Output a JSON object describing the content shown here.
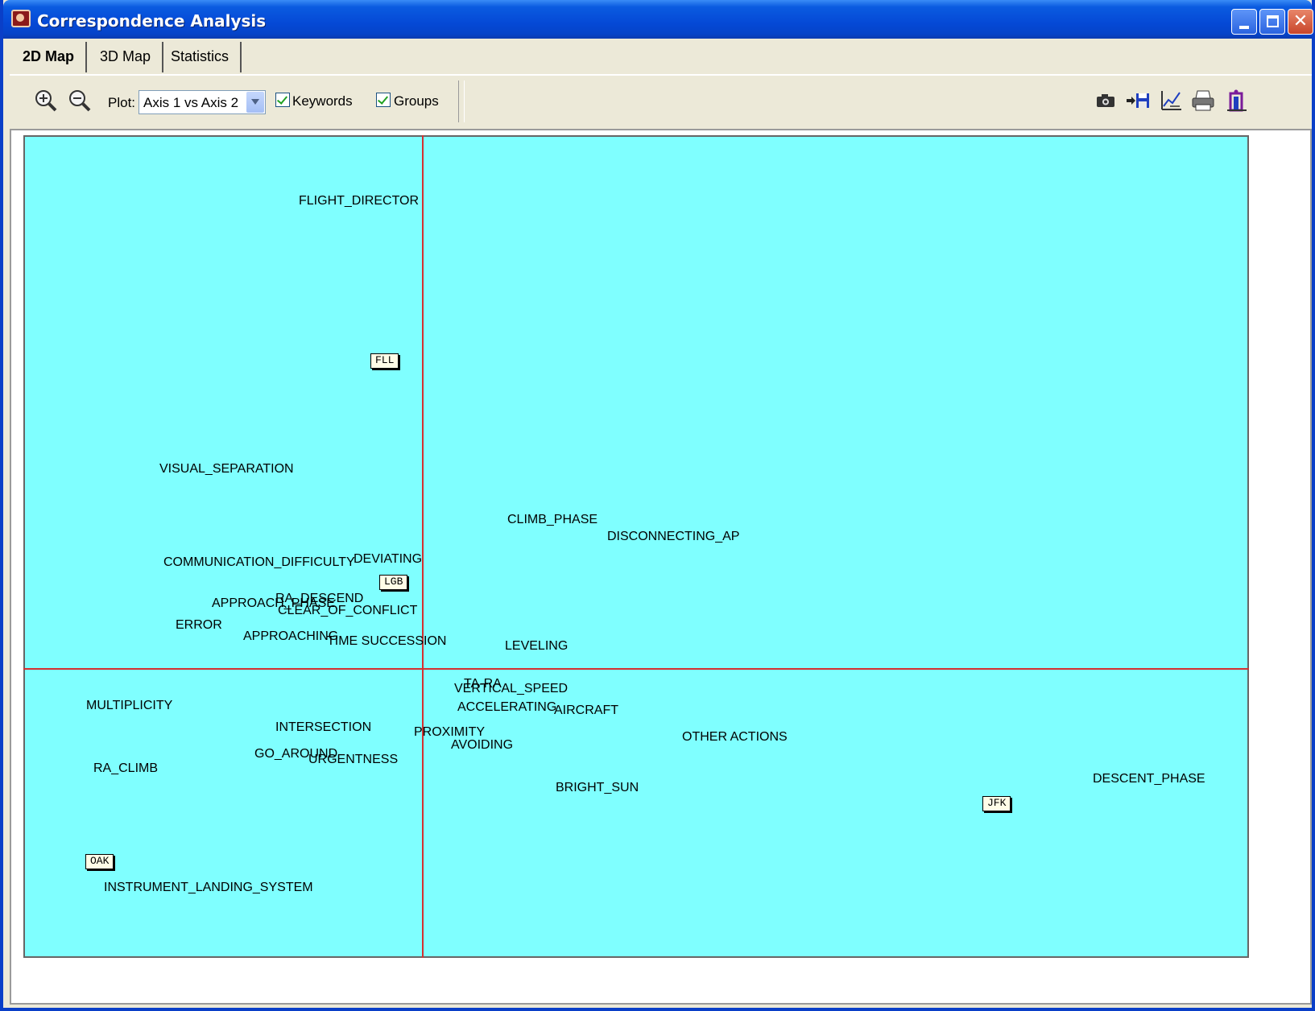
{
  "window": {
    "title": "Correspondence Analysis",
    "controls": {
      "minimize": "minimize",
      "maximize": "maximize",
      "close": "✕"
    }
  },
  "tabs": [
    {
      "label": "2D Map",
      "active": true
    },
    {
      "label": "3D Map",
      "active": false
    },
    {
      "label": "Statistics",
      "active": false
    }
  ],
  "toolbar": {
    "zoom_in_icon": "zoom-in-icon",
    "zoom_out_icon": "zoom-out-icon",
    "plot_label": "Plot:",
    "plot_value": "Axis 1 vs Axis 2",
    "keywords_label": "Keywords",
    "keywords_checked": true,
    "groups_label": "Groups",
    "groups_checked": true,
    "right_icons": [
      "camera-icon",
      "export-save-icon",
      "chart-settings-icon",
      "print-icon",
      "exit-icon"
    ]
  },
  "map": {
    "background": "#7fffff",
    "axis_color": "#d43030",
    "keywords": [
      "FLIGHT_DIRECTOR",
      "VISUAL_SEPARATION",
      "CLIMB_PHASE",
      "DISCONNECTING_AP",
      "COMMUNICATION_DIFFICULTY",
      "DEVIATING",
      "RA_DESCEND",
      "APPROACH_PHASE",
      "CLEAR_OF_CONFLICT",
      "ERROR",
      "APPROACHING",
      "TIME SUCCESSION",
      "LEVELING",
      "TA-RA",
      "VERTICAL_SPEED",
      "MULTIPLICITY",
      "ACCELERATING",
      "AIRCRAFT",
      "INTERSECTION",
      "PROXIMITY",
      "AVOIDING",
      "OTHER ACTIONS",
      "GO_AROUND",
      "URGENTNESS",
      "RA_CLIMB",
      "BRIGHT_SUN",
      "DESCENT_PHASE",
      "INSTRUMENT_LANDING_SYSTEM"
    ],
    "groups": [
      "FLL",
      "LGB",
      "JFK",
      "OAK"
    ]
  }
}
